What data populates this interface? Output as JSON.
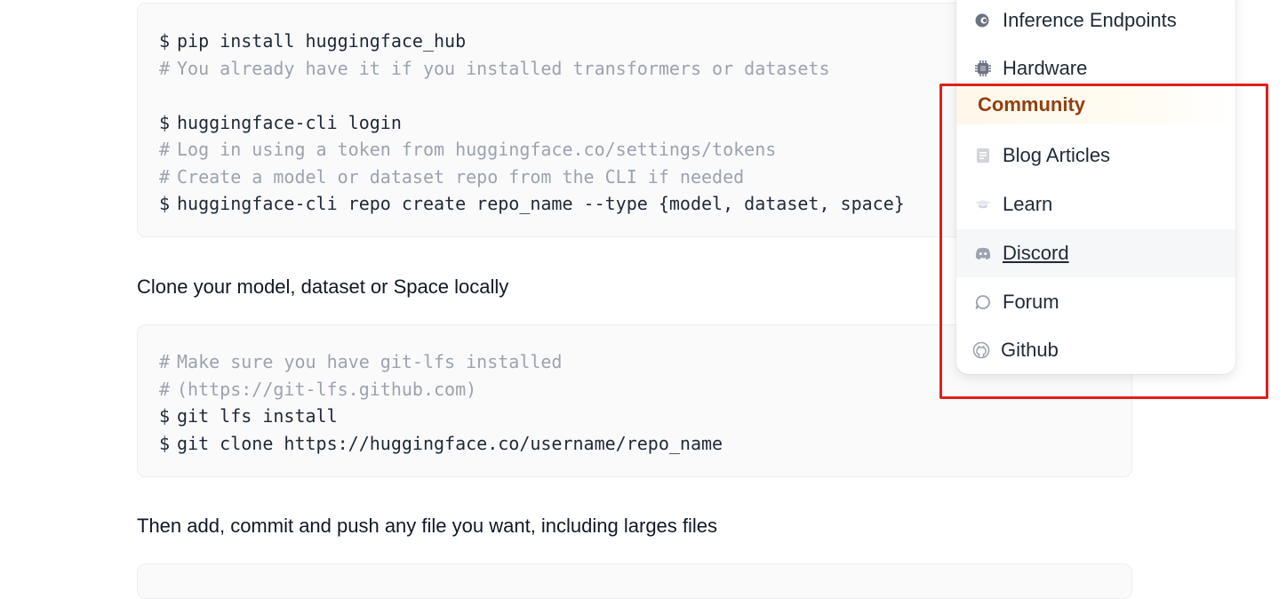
{
  "code_block_1": {
    "lines": [
      {
        "prompt": "$",
        "text": "pip install huggingface_hub",
        "type": "command"
      },
      {
        "prompt": "#",
        "text": "You already have it if you installed transformers or datasets",
        "type": "comment"
      },
      {
        "prompt": "",
        "text": "",
        "type": "blank"
      },
      {
        "prompt": "$",
        "text": "huggingface-cli login",
        "type": "command"
      },
      {
        "prompt": "#",
        "text": "Log in using a token from huggingface.co/settings/tokens",
        "type": "comment"
      },
      {
        "prompt": "#",
        "text": "Create a model or dataset repo from the CLI if needed",
        "type": "comment"
      },
      {
        "prompt": "$",
        "text": "huggingface-cli repo create repo_name --type {model, dataset, space}",
        "type": "command"
      }
    ]
  },
  "paragraph_clone": "Clone your model, dataset or Space locally",
  "code_block_2": {
    "lines": [
      {
        "prompt": "#",
        "text": "Make sure you have git-lfs installed",
        "type": "comment"
      },
      {
        "prompt": "#",
        "text": "(https://git-lfs.github.com)",
        "type": "comment"
      },
      {
        "prompt": "$",
        "text": "git lfs install",
        "type": "command"
      },
      {
        "prompt": "$",
        "text": "git clone https://huggingface.co/username/repo_name",
        "type": "command"
      }
    ]
  },
  "paragraph_push": "Then add, commit and push any file you want, including larges files",
  "menu": {
    "top_items": [
      {
        "label": "Inference Endpoints",
        "icon": "inference-endpoints-icon"
      },
      {
        "label": "Hardware",
        "icon": "chip-icon"
      }
    ],
    "section_header": "Community",
    "community_items": [
      {
        "label": "Blog Articles",
        "icon": "document-icon"
      },
      {
        "label": "Learn",
        "icon": "graduation-cap-icon"
      },
      {
        "label": "Discord",
        "icon": "discord-icon"
      },
      {
        "label": "Forum",
        "icon": "chat-bubble-icon"
      },
      {
        "label": "Github",
        "icon": "github-icon"
      }
    ],
    "hovered_item": "Discord"
  },
  "colors": {
    "section_header_text": "#92400e",
    "highlight_box": "#e0201a",
    "comment_text": "#9ca3af"
  }
}
